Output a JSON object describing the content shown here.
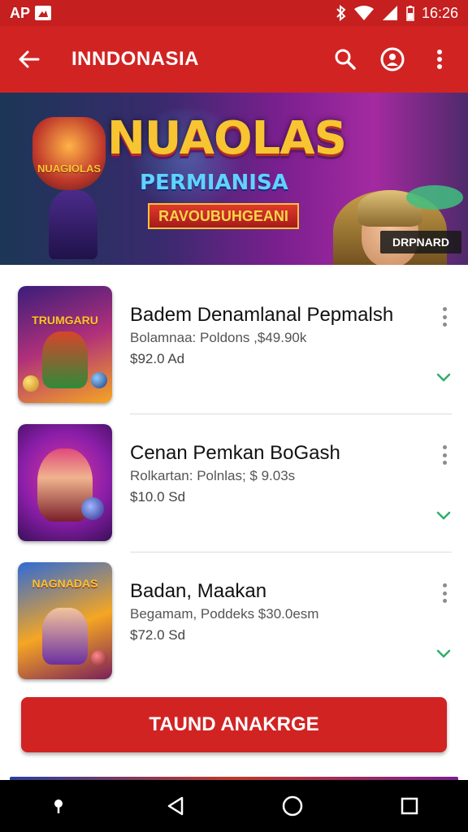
{
  "status_bar": {
    "carrier": "AP",
    "time": "16:26"
  },
  "app_bar": {
    "title": "INNDONASIA",
    "icons": [
      "back-arrow-icon",
      "search-icon",
      "profile-icon",
      "more-vertical-icon"
    ]
  },
  "banner": {
    "title": "NUAOLAS",
    "subtitle": "PERMIANISA",
    "ribbon": "RAVOUBUHGEANI",
    "emblem": "NUAGIOLAS",
    "badge": "DRPNARD"
  },
  "games": [
    {
      "name": "Badem Denamlanal Pepmalsh",
      "subtitle": "Bolamnaa: Poldons ,$49.90k",
      "price": "$92.0 Ad",
      "thumb_title": "TRUMGARU",
      "thumb_colors": [
        "#f5a623",
        "#6b2fa0",
        "#1d3a7a"
      ]
    },
    {
      "name": "Cenan Pemkan BoGash",
      "subtitle": "Rolkartan: Polnlas; $ 9.03s",
      "price": "$10.0 Sd",
      "thumb_title": "",
      "thumb_colors": [
        "#8a1ea8",
        "#e0399e",
        "#3a0f5a"
      ]
    },
    {
      "name": "Badan, Maakan",
      "subtitle": "Begamam, Poddeks $30.0esm",
      "price": "$72.0 Sd",
      "thumb_title": "NAGNADAS",
      "thumb_colors": [
        "#2f6ad6",
        "#f5a623",
        "#7a1f5a"
      ]
    }
  ],
  "cta": {
    "label": "TAUND ANAKRGE"
  },
  "colors": {
    "primary": "#d22323",
    "status": "#c51f1f",
    "accent_green": "#2fae6a"
  }
}
